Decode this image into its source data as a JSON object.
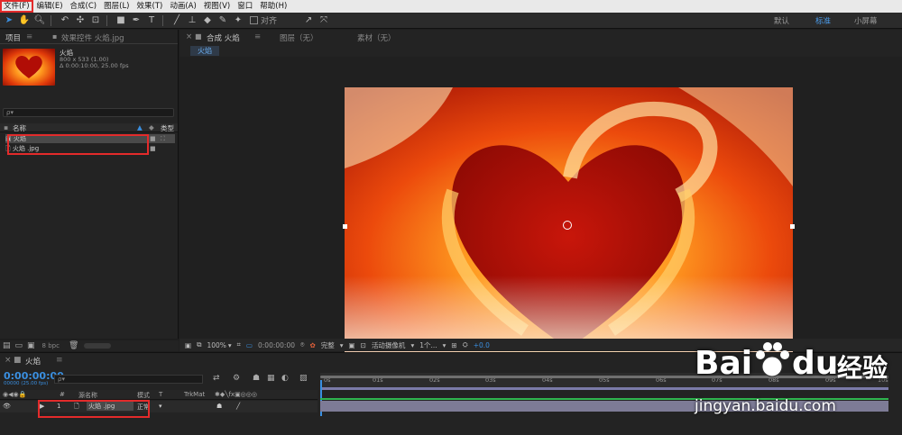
{
  "menubar": {
    "items": [
      "文件(F)",
      "编辑(E)",
      "合成(C)",
      "图层(L)",
      "效果(T)",
      "动画(A)",
      "视图(V)",
      "窗口",
      "帮助(H)"
    ]
  },
  "toolbar": {
    "snap_label": "对齐",
    "workspaces": [
      "默认",
      "标准",
      "小屏幕"
    ],
    "active_workspace": "标准"
  },
  "project": {
    "tab_label": "项目",
    "effect_tab_label": "效果控件 火焰.jpg",
    "item_name": "火焰",
    "item_info_1": "800 x 533 (1.00)",
    "item_info_2": "Δ 0:00:10:00, 25.00 fps",
    "search_placeholder": "ρ▾",
    "columns": {
      "name": "名称",
      "type": "类型"
    },
    "rows": [
      {
        "name": "火焰",
        "type": ""
      },
      {
        "name": "火焰 .jpg",
        "type": ""
      }
    ],
    "bit_depth": "8 bpc"
  },
  "composition": {
    "tab_label": "合成 火焰",
    "layer_tab": "图层（无）",
    "footage_tab": "素材（无）",
    "flow_label": "火焰"
  },
  "viewer": {
    "zoom": "100%",
    "timecode": "0:00:00:00",
    "resolution": "完整",
    "camera": "活动摄像机",
    "views": "1个...",
    "exposure": "+0.0"
  },
  "timeline": {
    "tab_label": "火焰",
    "timecode": "0:00:00:00",
    "frames_info": "00000 (25.00 fps)",
    "search_placeholder": "ρ▾",
    "column_source": "源名称",
    "column_mode": "模式",
    "column_trkmat": "TrkMat",
    "ruler_ticks": [
      "0s",
      "01s",
      "02s",
      "03s",
      "04s",
      "05s",
      "06s",
      "07s",
      "08s",
      "09s",
      "10s"
    ],
    "layer_index": "1",
    "layer_name": "火焰 .jpg",
    "layer_mode": "正常"
  },
  "watermark": {
    "brand_latin": "Bai",
    "brand_latin_2": "du",
    "brand_cn": "经验",
    "url": "jingyan.baidu.com"
  },
  "colors": {
    "accent": "#3a8fe0",
    "highlight": "#e32b2b"
  }
}
